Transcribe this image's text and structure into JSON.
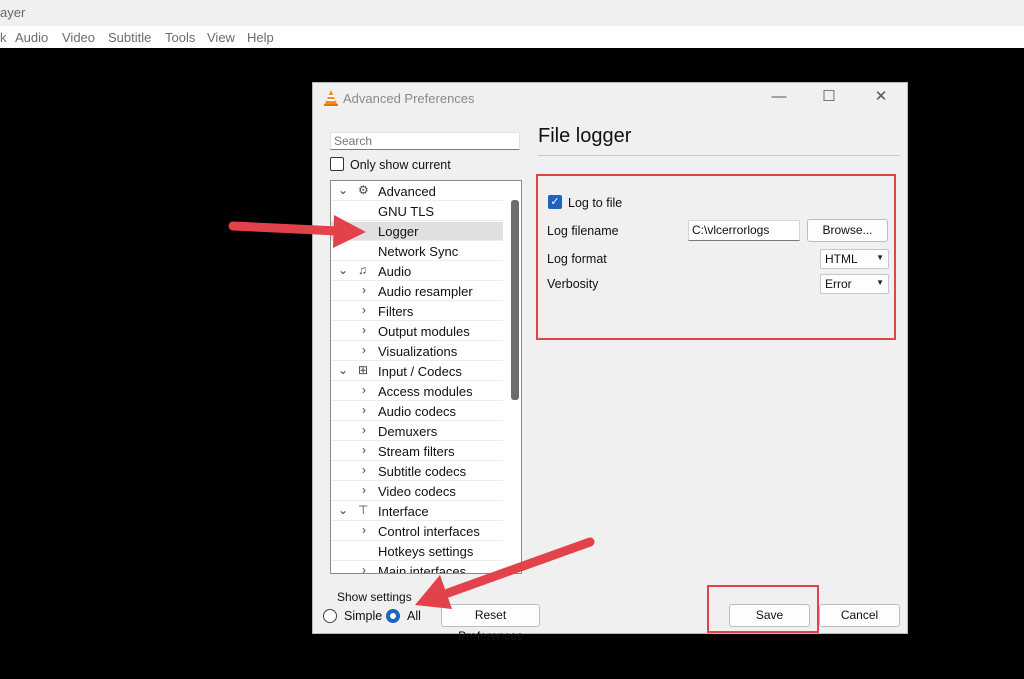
{
  "player": {
    "title_fragment": "ayer",
    "menu": [
      "Audio",
      "Video",
      "Subtitle",
      "Tools",
      "View",
      "Help"
    ],
    "menu_first_fragment": "k"
  },
  "dialog": {
    "title": "Advanced Preferences",
    "search_placeholder": "Search",
    "only_show_current": "Only show current",
    "tree": [
      {
        "label": "Advanced",
        "level": 0,
        "expanded": true,
        "icon": "gear-icon"
      },
      {
        "label": "GNU TLS",
        "level": 1
      },
      {
        "label": "Logger",
        "level": 1,
        "selected": true
      },
      {
        "label": "Network Sync",
        "level": 1
      },
      {
        "label": "Audio",
        "level": 0,
        "expanded": true,
        "icon": "music-note-icon"
      },
      {
        "label": "Audio resampler",
        "level": 1,
        "chevron": true
      },
      {
        "label": "Filters",
        "level": 1,
        "chevron": true
      },
      {
        "label": "Output modules",
        "level": 1,
        "chevron": true
      },
      {
        "label": "Visualizations",
        "level": 1,
        "chevron": true
      },
      {
        "label": "Input / Codecs",
        "level": 0,
        "expanded": true,
        "icon": "codec-icon"
      },
      {
        "label": "Access modules",
        "level": 1,
        "chevron": true
      },
      {
        "label": "Audio codecs",
        "level": 1,
        "chevron": true
      },
      {
        "label": "Demuxers",
        "level": 1,
        "chevron": true
      },
      {
        "label": "Stream filters",
        "level": 1,
        "chevron": true
      },
      {
        "label": "Subtitle codecs",
        "level": 1,
        "chevron": true
      },
      {
        "label": "Video codecs",
        "level": 1,
        "chevron": true
      },
      {
        "label": "Interface",
        "level": 0,
        "expanded": true,
        "icon": "paint-roller-icon"
      },
      {
        "label": "Control interfaces",
        "level": 1,
        "chevron": true
      },
      {
        "label": "Hotkeys settings",
        "level": 1
      },
      {
        "label": "Main interfaces",
        "level": 1,
        "chevron": true
      }
    ],
    "panel": {
      "title": "File logger",
      "log_to_file": "Log to file",
      "log_filename_label": "Log filename",
      "log_filename_value": "C:\\vlcerrorlogs",
      "browse": "Browse...",
      "log_format_label": "Log format",
      "log_format_value": "HTML",
      "verbosity_label": "Verbosity",
      "verbosity_value": "Error"
    },
    "show_settings": "Show settings",
    "simple": "Simple",
    "all": "All",
    "reset": "Reset Preferences",
    "save": "Save",
    "cancel": "Cancel"
  },
  "colors": {
    "accent": "#1f63c0",
    "highlight_red": "#e2424a"
  }
}
